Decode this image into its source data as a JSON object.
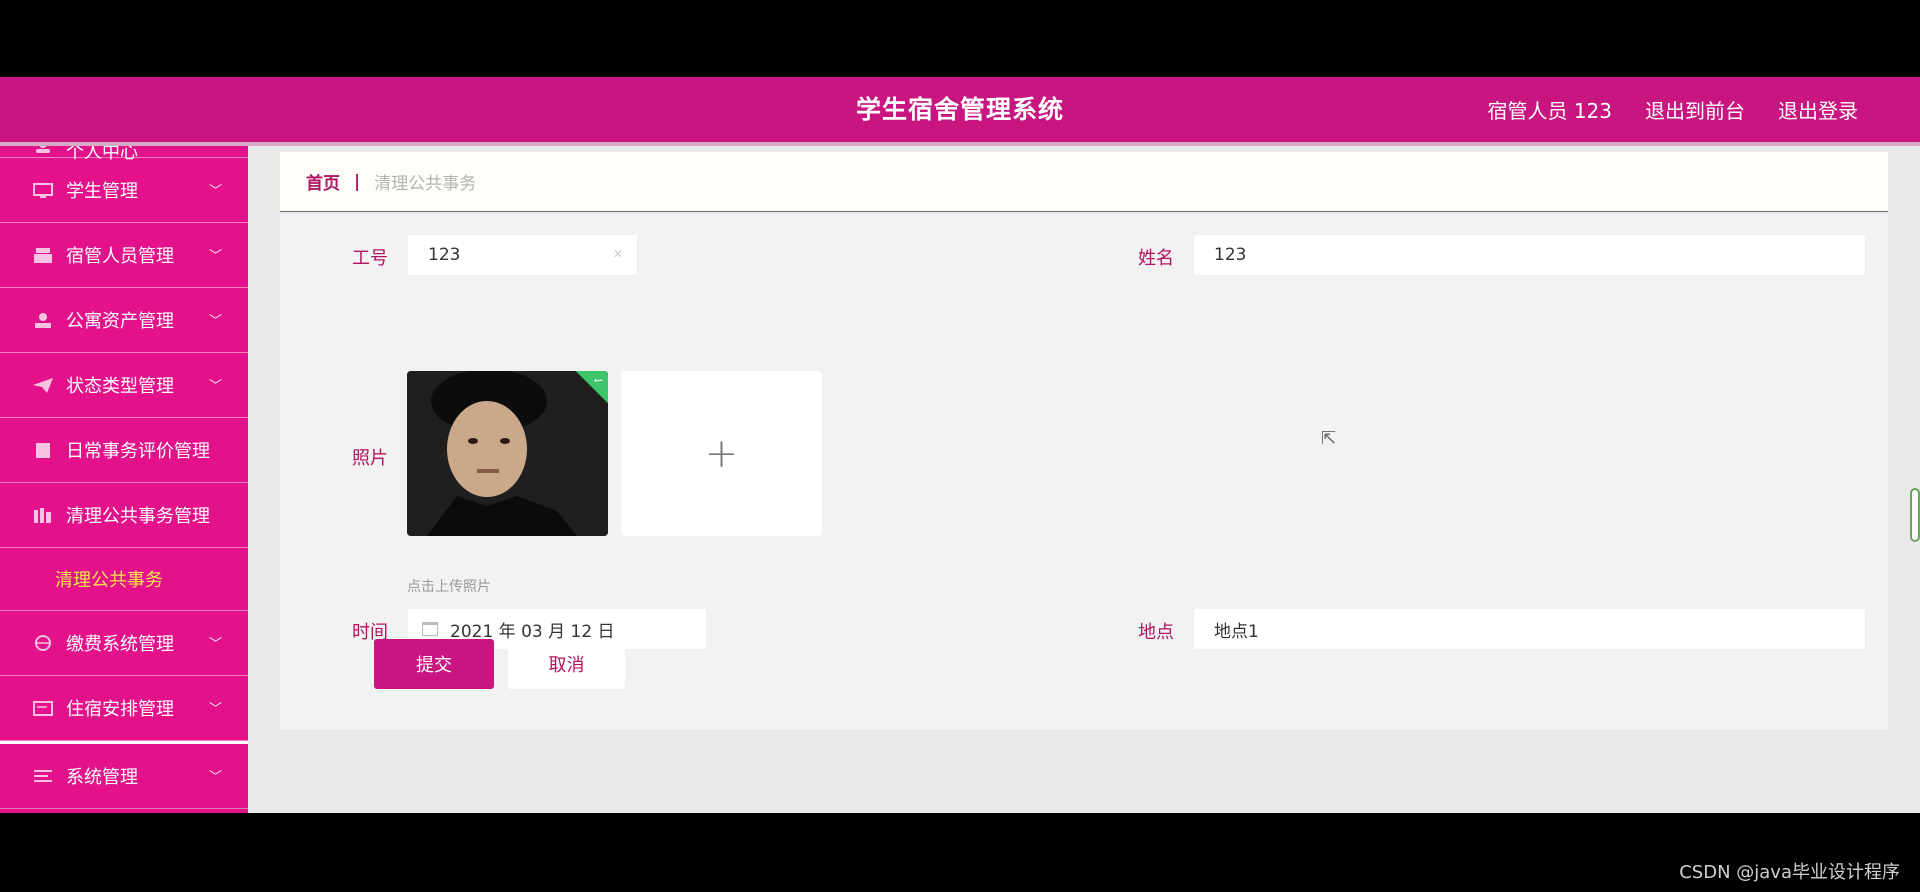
{
  "header": {
    "title": "学生宿舍管理系统",
    "user_label": "宿管人员 123",
    "front_link": "退出到前台",
    "logout_link": "退出登录"
  },
  "sidebar": {
    "items": [
      {
        "label": "个人中心",
        "icon": "user-icon"
      },
      {
        "label": "学生管理",
        "icon": "monitor-icon"
      },
      {
        "label": "宿管人员管理",
        "icon": "staff-icon"
      },
      {
        "label": "公寓资产管理",
        "icon": "person-icon"
      },
      {
        "label": "状态类型管理",
        "icon": "send-icon"
      },
      {
        "label": "日常事务评价管理",
        "icon": "doc-icon"
      },
      {
        "label": "清理公共事务管理",
        "icon": "chart-icon"
      },
      {
        "label": "缴费系统管理",
        "icon": "globe-icon"
      },
      {
        "label": "住宿安排管理",
        "icon": "board-icon"
      },
      {
        "label": "系统管理",
        "icon": "menu-icon"
      }
    ],
    "submenu_label": "清理公共事务"
  },
  "breadcrumb": {
    "home": "首页",
    "separator": "|",
    "current": "清理公共事务"
  },
  "form": {
    "employee_id_label": "工号",
    "employee_id_value": "123",
    "name_label": "姓名",
    "name_value": "123",
    "photo_label": "照片",
    "upload_hint": "点击上传照片",
    "time_label": "时间",
    "time_value": "2021 年 03 月 12 日",
    "location_label": "地点",
    "location_value": "地点1",
    "submit_label": "提交",
    "cancel_label": "取消"
  },
  "watermark": "CSDN @java毕业设计程序"
}
